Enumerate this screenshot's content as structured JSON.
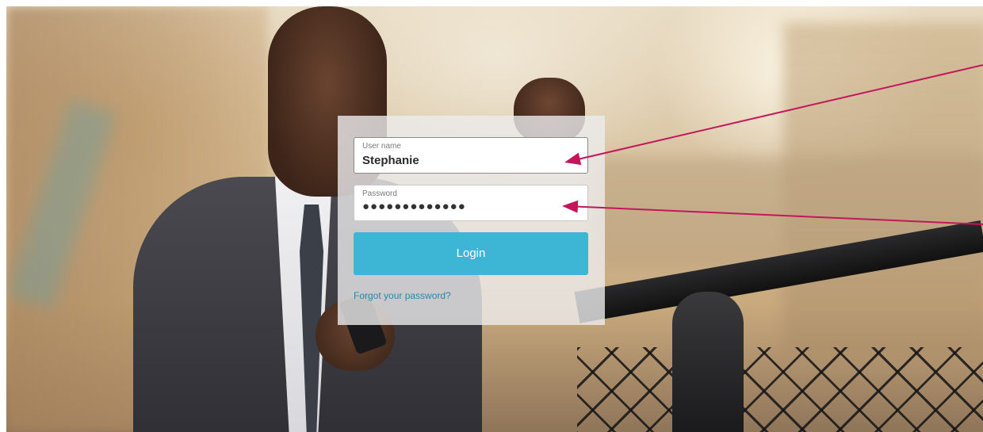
{
  "login_form": {
    "username_label": "User name",
    "username_value": "Stephanie",
    "password_label": "Password",
    "password_value": "●●●●●●●●●●●●●",
    "login_button_label": "Login",
    "forgot_password_link": "Forgot your password?"
  },
  "colors": {
    "login_button": "#3db6d6",
    "link": "#2a86b0",
    "annotation_arrow": "#c2185b"
  }
}
